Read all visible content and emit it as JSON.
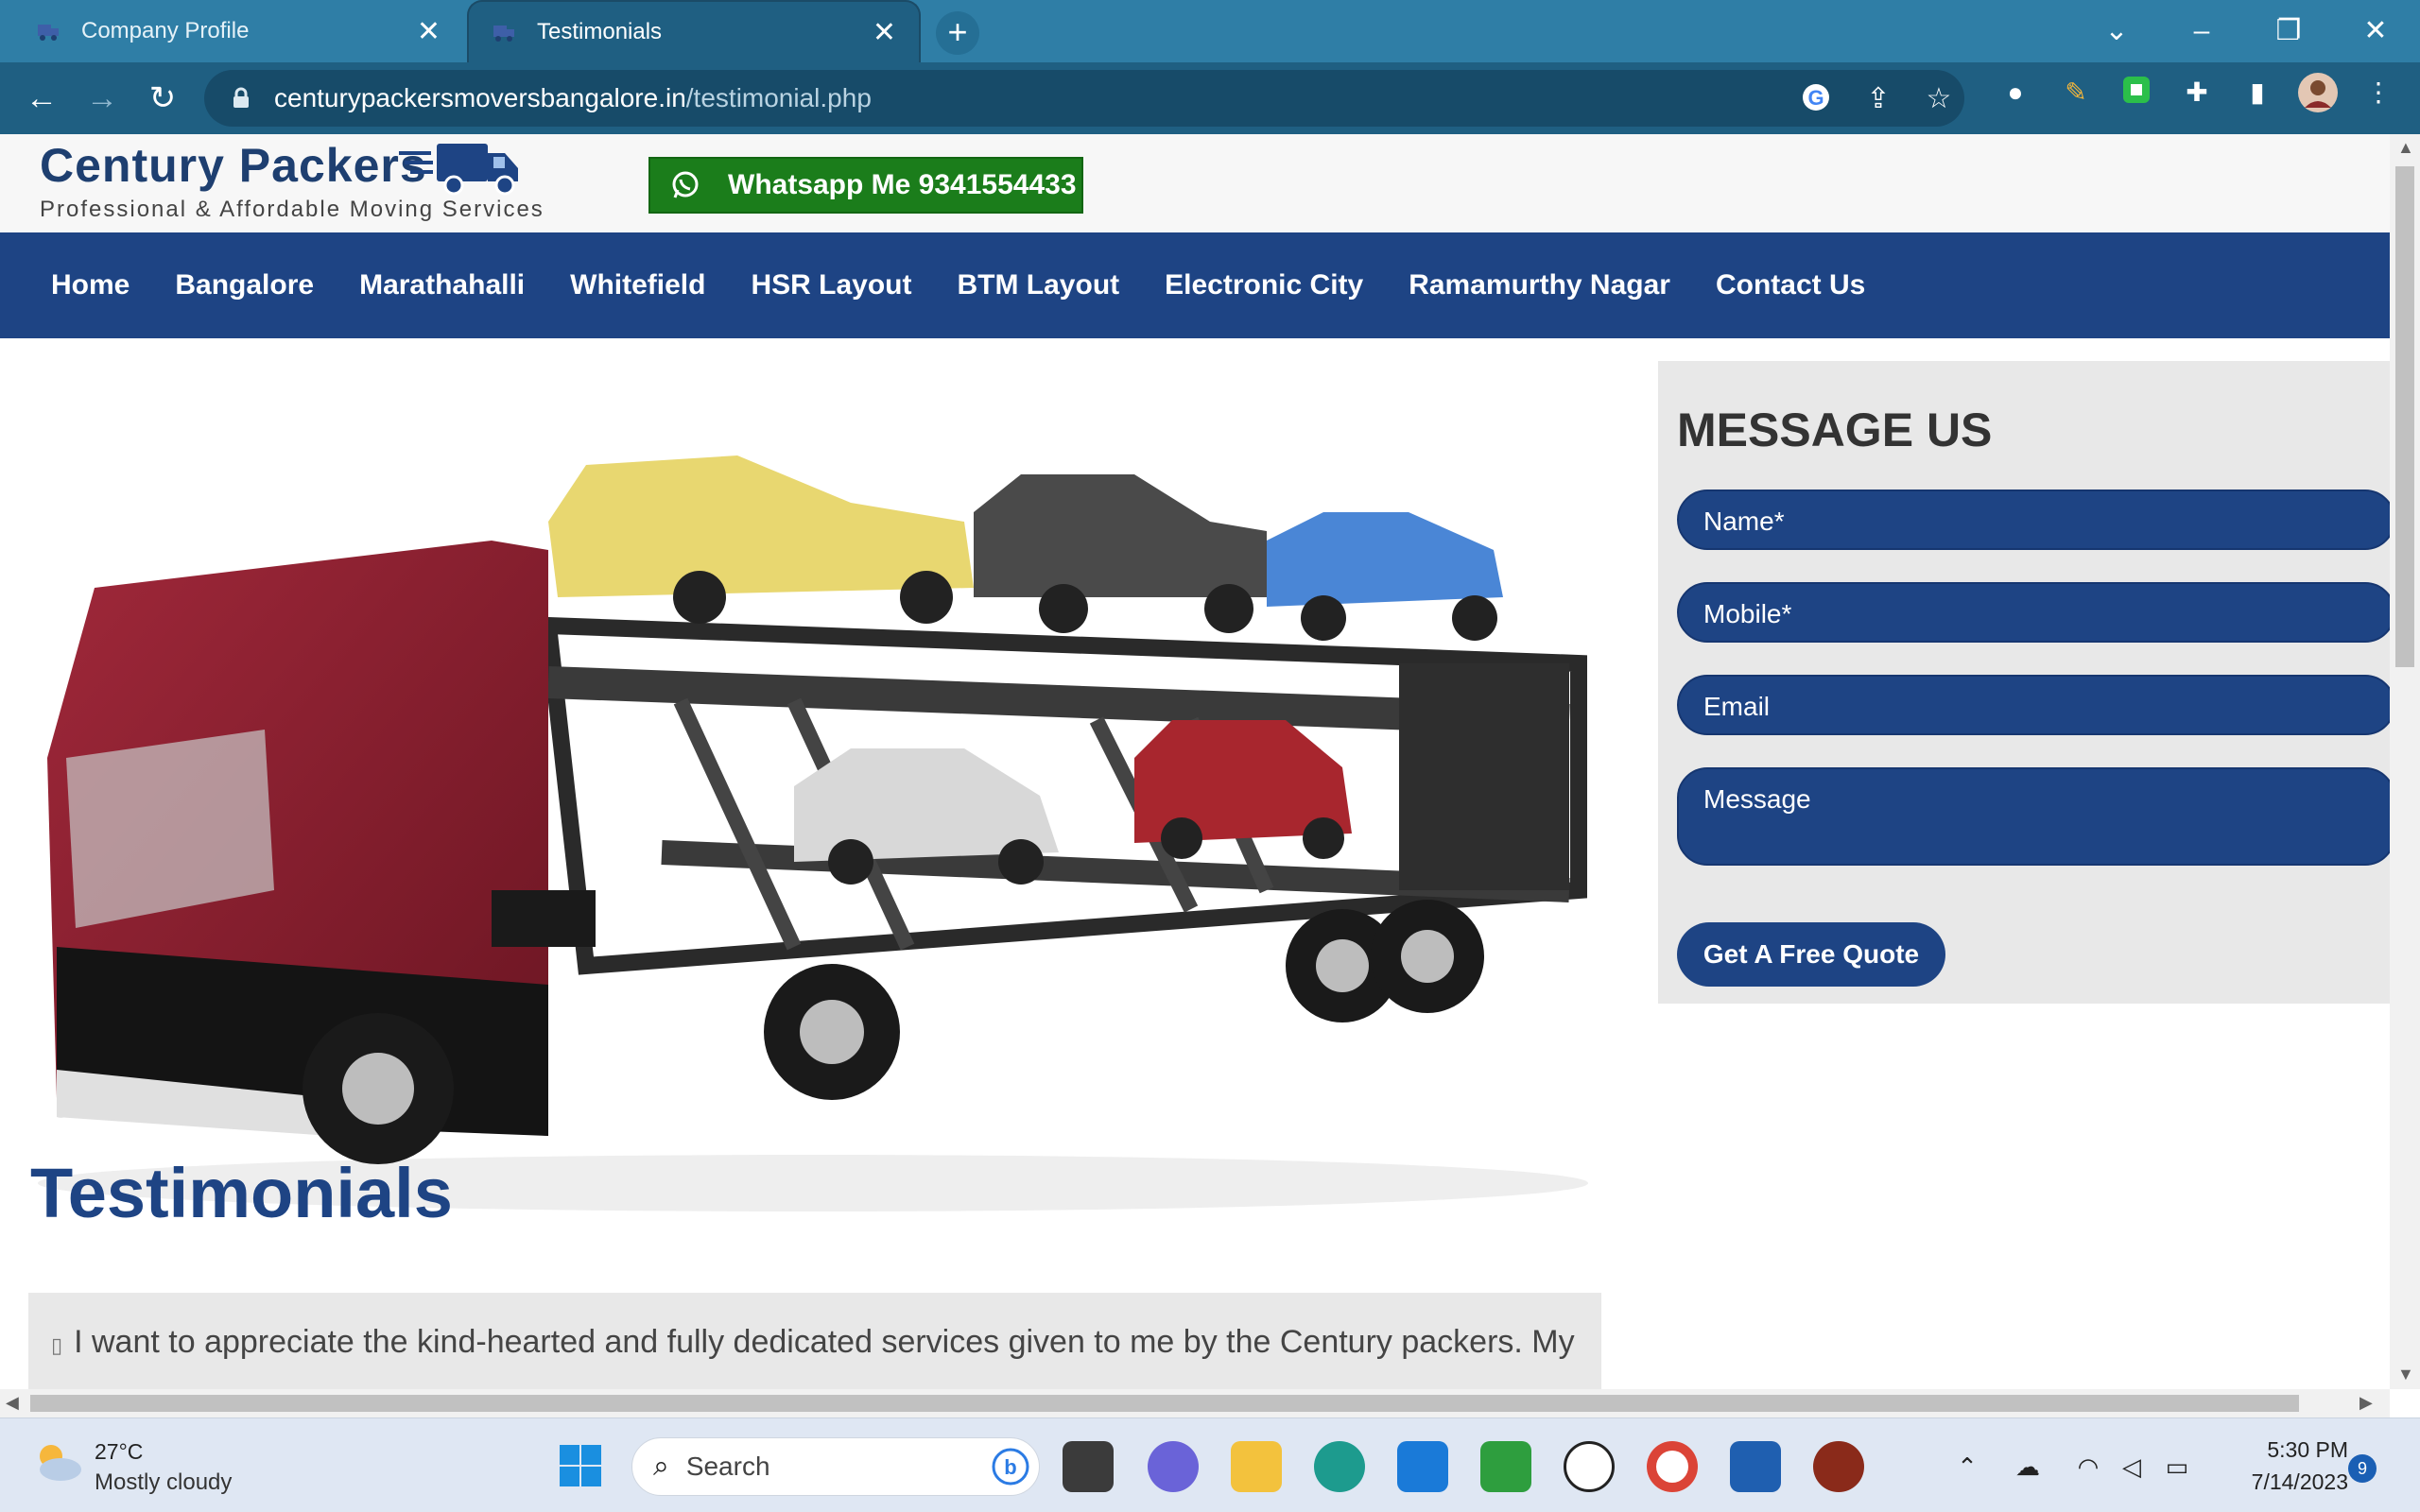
{
  "browser": {
    "tabs": [
      {
        "title": "Company Profile",
        "active": false
      },
      {
        "title": "Testimonials",
        "active": true
      }
    ],
    "url_host": "centurypackersmoversbangalore.in",
    "url_path": "/testimonial.php",
    "colors": {
      "frame": "#2f7ea6",
      "toolbar": "#1f5f82"
    }
  },
  "site": {
    "logo_title": "Century Packers",
    "logo_tagline": "Professional & Affordable Moving Services",
    "whatsapp_label": "Whatsapp Me 9341554433",
    "nav": [
      "Home",
      "Bangalore",
      "Marathahalli",
      "Whitefield",
      "HSR Layout",
      "BTM Layout",
      "Electronic City",
      "Ramamurthy Nagar",
      "Contact Us"
    ],
    "form": {
      "title": "MESSAGE US",
      "name_placeholder": "Name*",
      "mobile_placeholder": "Mobile*",
      "email_placeholder": "Email",
      "message_placeholder": "Message",
      "submit_label": "Get A Free Quote"
    },
    "testimonials_heading": "Testimonials",
    "testimonial_text": "I want to appreciate the kind-hearted and fully dedicated services given to me by the Century packers. My",
    "colors": {
      "brand_blue": "#1e4484",
      "whatsapp_green": "#1b7d1b"
    }
  },
  "taskbar": {
    "weather_temp": "27°C",
    "weather_desc": "Mostly cloudy",
    "search_label": "Search",
    "time": "5:30 PM",
    "date": "7/14/2023",
    "notification_count": "9"
  }
}
